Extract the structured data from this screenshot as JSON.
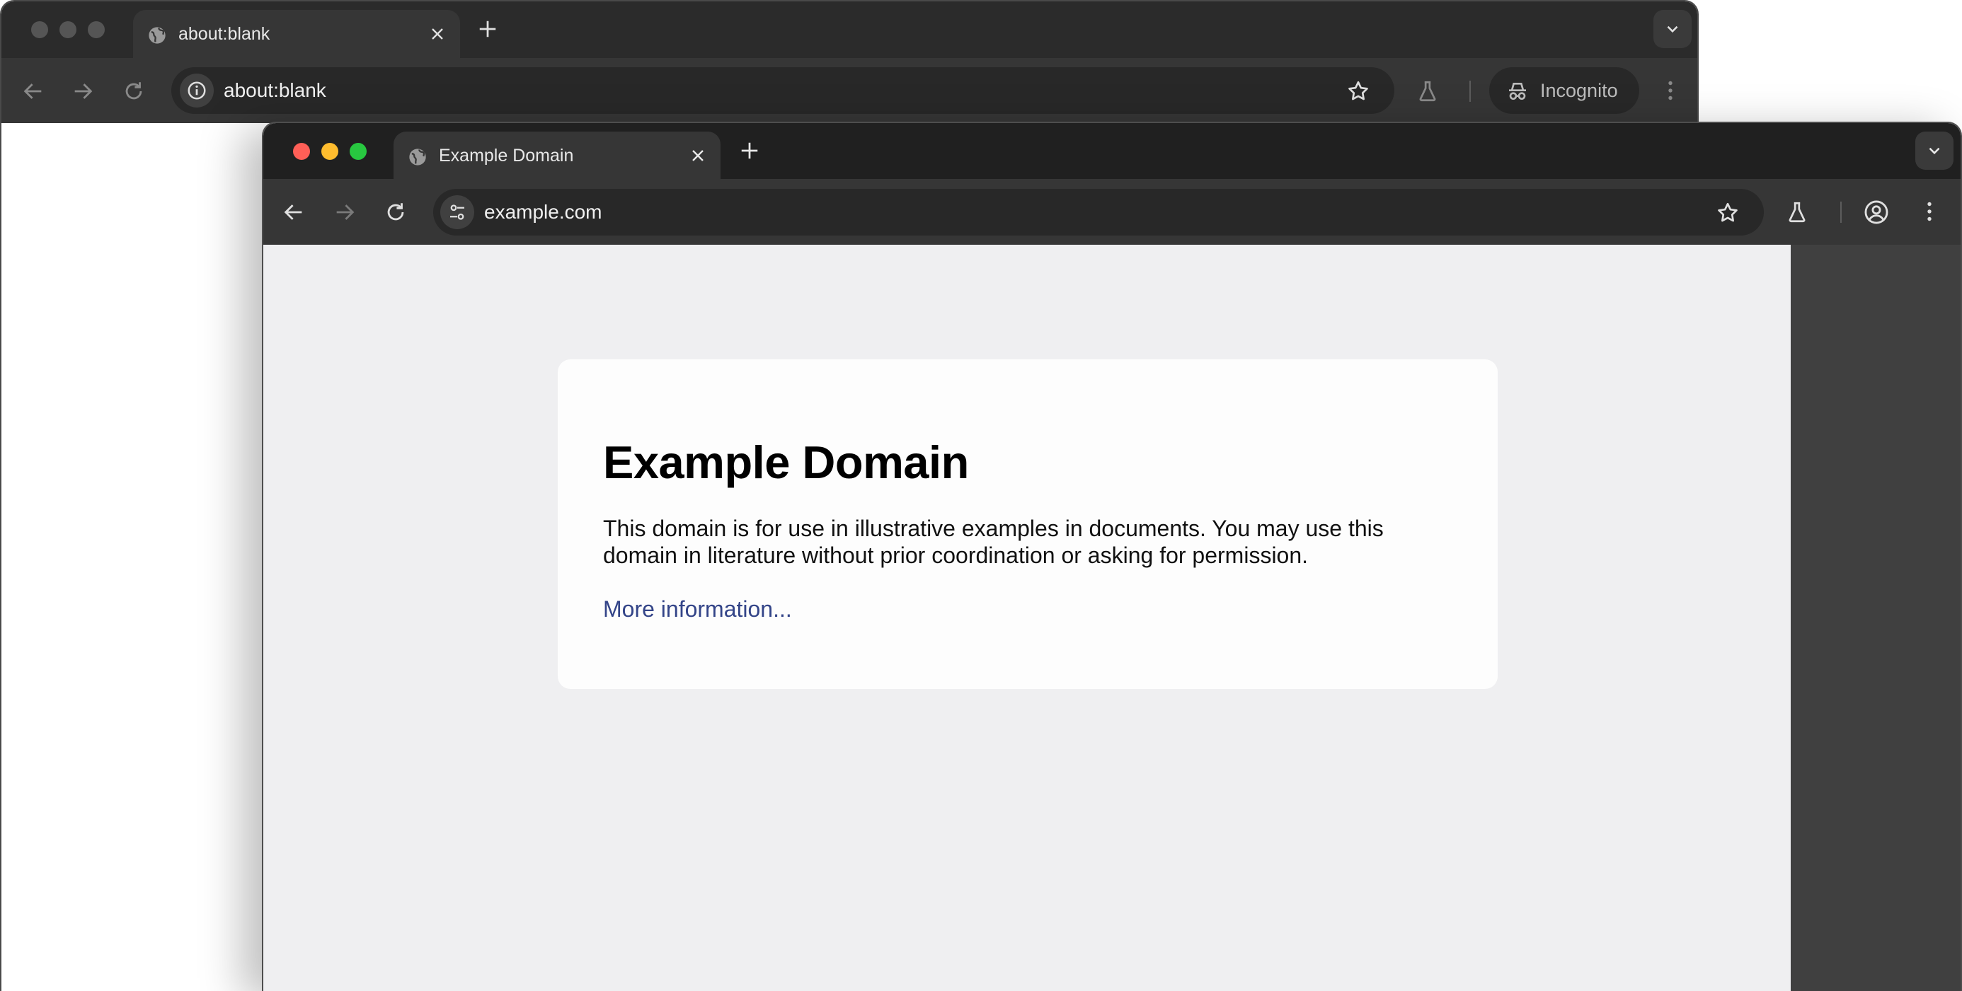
{
  "back_window": {
    "tab": {
      "title": "about:blank"
    },
    "omnibox": {
      "url": "about:blank"
    },
    "incognito_label": "Incognito"
  },
  "front_window": {
    "tab": {
      "title": "Example Domain"
    },
    "omnibox": {
      "url": "example.com"
    },
    "page": {
      "heading": "Example Domain",
      "body": "This domain is for use in illustrative examples in documents. You may use this domain in literature without prior coordination or asking for permission.",
      "link": "More information..."
    }
  },
  "icons": {
    "traffic_close": "#ff5f57",
    "traffic_minimize": "#febc2e",
    "traffic_zoom": "#28c840",
    "traffic_inactive": "#555555"
  }
}
